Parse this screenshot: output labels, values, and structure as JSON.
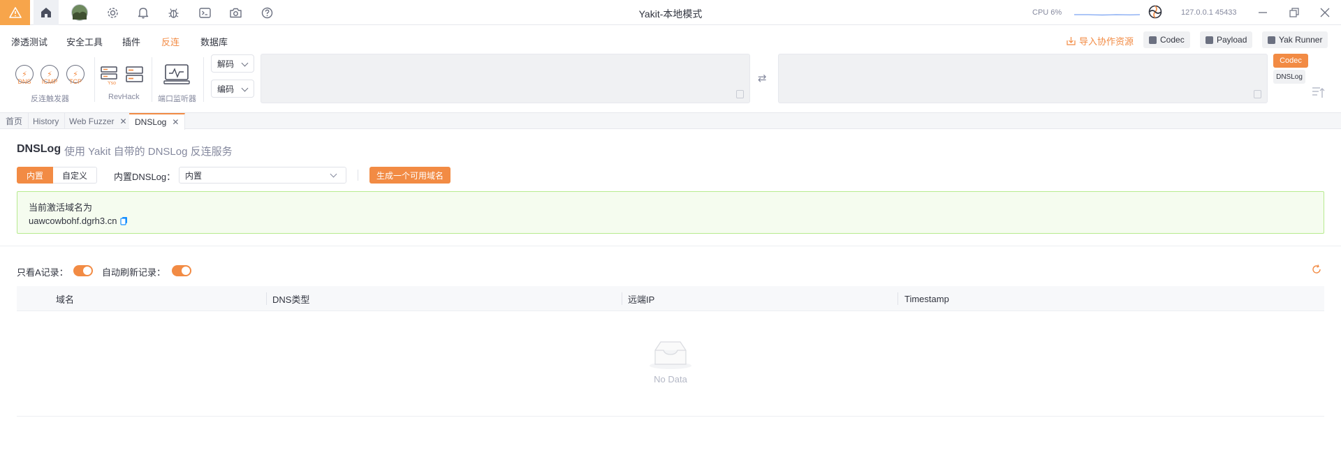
{
  "titlebar": {
    "title": "Yakit-本地模式",
    "cpu": "CPU 6%",
    "address": "127.0.0.1 45433"
  },
  "menu": {
    "items": [
      "渗透测试",
      "安全工具",
      "插件",
      "反连",
      "数据库"
    ],
    "active": "反连",
    "import_link": "导入协作资源",
    "buttons": [
      "Codec",
      "Payload",
      "Yak Runner"
    ]
  },
  "toolbar": {
    "trigger_labels": [
      "DNS",
      "ICMP",
      "TCP"
    ],
    "groups": [
      "反连触发器",
      "RevHack",
      "端口监听器"
    ],
    "decode_label": "解码",
    "encode_label": "编码",
    "codec_chip": "Codec",
    "dnslog_chip": "DNSLog"
  },
  "tabs": [
    {
      "label": "首页",
      "closable": false
    },
    {
      "label": "History",
      "closable": false
    },
    {
      "label": "Web Fuzzer",
      "closable": true
    },
    {
      "label": "DNSLog",
      "closable": true,
      "active": true
    }
  ],
  "dnslog": {
    "title": "DNSLog",
    "subtitle": "使用 Yakit 自带的 DNSLog 反连服务",
    "mode_builtin": "内置",
    "mode_custom": "自定义",
    "builtin_label": "内置DNSLog：",
    "builtin_value": "内置",
    "generate_button": "生成一个可用域名",
    "active_domain_caption": "当前激活域名为",
    "active_domain": "uawcowbohf.dgrh3.cn"
  },
  "filters": {
    "only_a_label": "只看A记录：",
    "only_a_on": true,
    "auto_refresh_label": "自动刷新记录：",
    "auto_refresh_on": true
  },
  "table": {
    "columns": [
      "域名",
      "DNS类型",
      "远端IP",
      "Timestamp"
    ],
    "rows": [],
    "empty_text": "No Data"
  },
  "colors": {
    "accent": "#f28b44",
    "success_bg": "#f5fcef",
    "success_border": "#b7eb8f"
  }
}
